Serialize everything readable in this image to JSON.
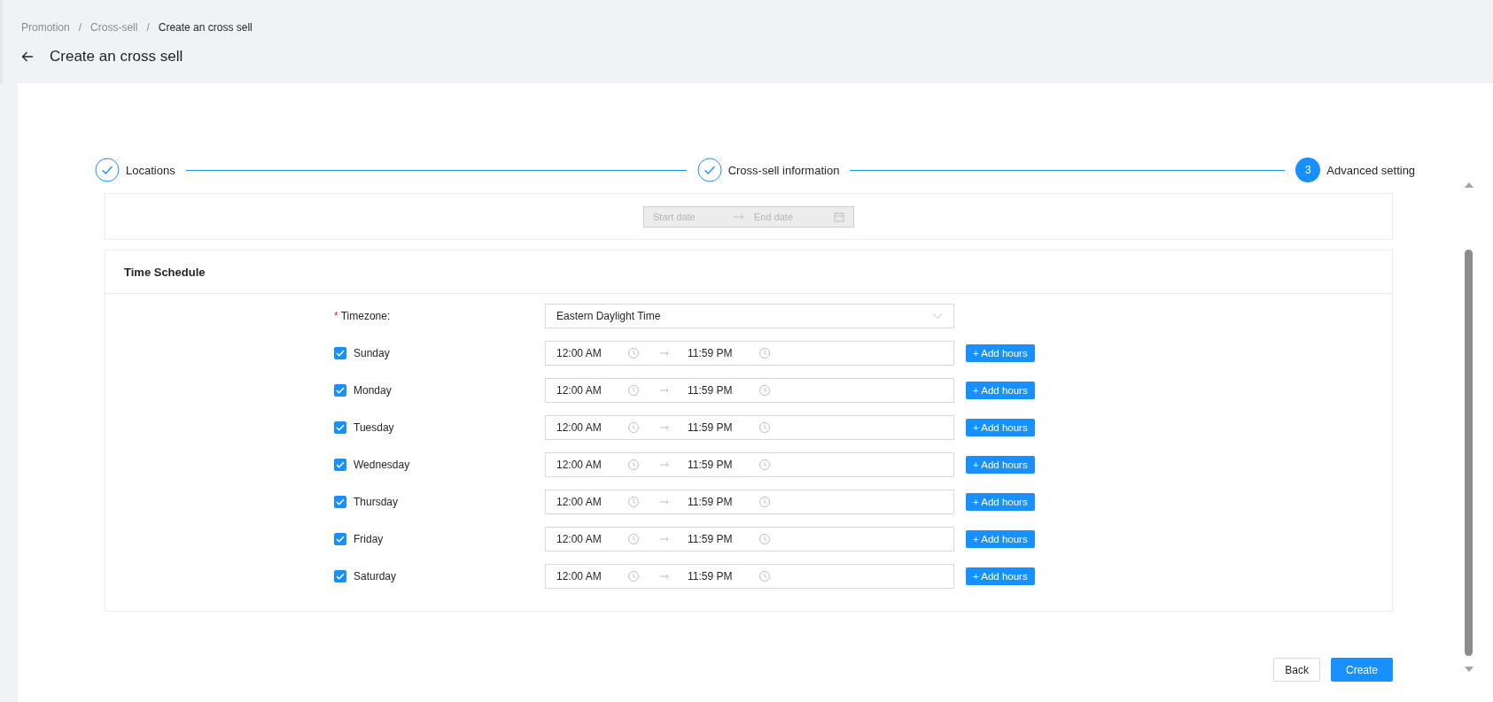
{
  "breadcrumb": [
    {
      "kind": "link",
      "label": "Promotion",
      "current": false
    },
    {
      "kind": "separator",
      "label": "/"
    },
    {
      "kind": "link",
      "label": "Cross-sell",
      "current": false
    },
    {
      "kind": "separator",
      "label": "/"
    },
    {
      "kind": "link",
      "label": "Create an cross sell",
      "current": true
    }
  ],
  "page_title": "Create an cross sell",
  "steps": [
    {
      "label": "Locations",
      "kind": "done"
    },
    {
      "label": "Cross-sell information",
      "kind": "done"
    },
    {
      "label": "Advanced setting",
      "kind": "current",
      "number": "3"
    }
  ],
  "date_range": {
    "start_placeholder": "Start date",
    "end_placeholder": "End date",
    "disabled": true
  },
  "time_schedule": {
    "title": "Time Schedule",
    "timezone": {
      "required_mark": "*",
      "label": "Timezone:",
      "value": "Eastern Daylight Time"
    },
    "days": [
      {
        "label": "Sunday",
        "checked": true,
        "start": "12:00 AM",
        "end": "11:59 PM",
        "button": "+ Add hours"
      },
      {
        "label": "Monday",
        "checked": true,
        "start": "12:00 AM",
        "end": "11:59 PM",
        "button": "+ Add hours"
      },
      {
        "label": "Tuesday",
        "checked": true,
        "start": "12:00 AM",
        "end": "11:59 PM",
        "button": "+ Add hours"
      },
      {
        "label": "Wednesday",
        "checked": true,
        "start": "12:00 AM",
        "end": "11:59 PM",
        "button": "+ Add hours"
      },
      {
        "label": "Thursday",
        "checked": true,
        "start": "12:00 AM",
        "end": "11:59 PM",
        "button": "+ Add hours"
      },
      {
        "label": "Friday",
        "checked": true,
        "start": "12:00 AM",
        "end": "11:59 PM",
        "button": "+ Add hours"
      },
      {
        "label": "Saturday",
        "checked": true,
        "start": "12:00 AM",
        "end": "11:59 PM",
        "button": "+ Add hours"
      }
    ]
  },
  "buttons": [
    {
      "label": "Back",
      "kind": "default"
    },
    {
      "label": "Create",
      "kind": "primary"
    }
  ]
}
